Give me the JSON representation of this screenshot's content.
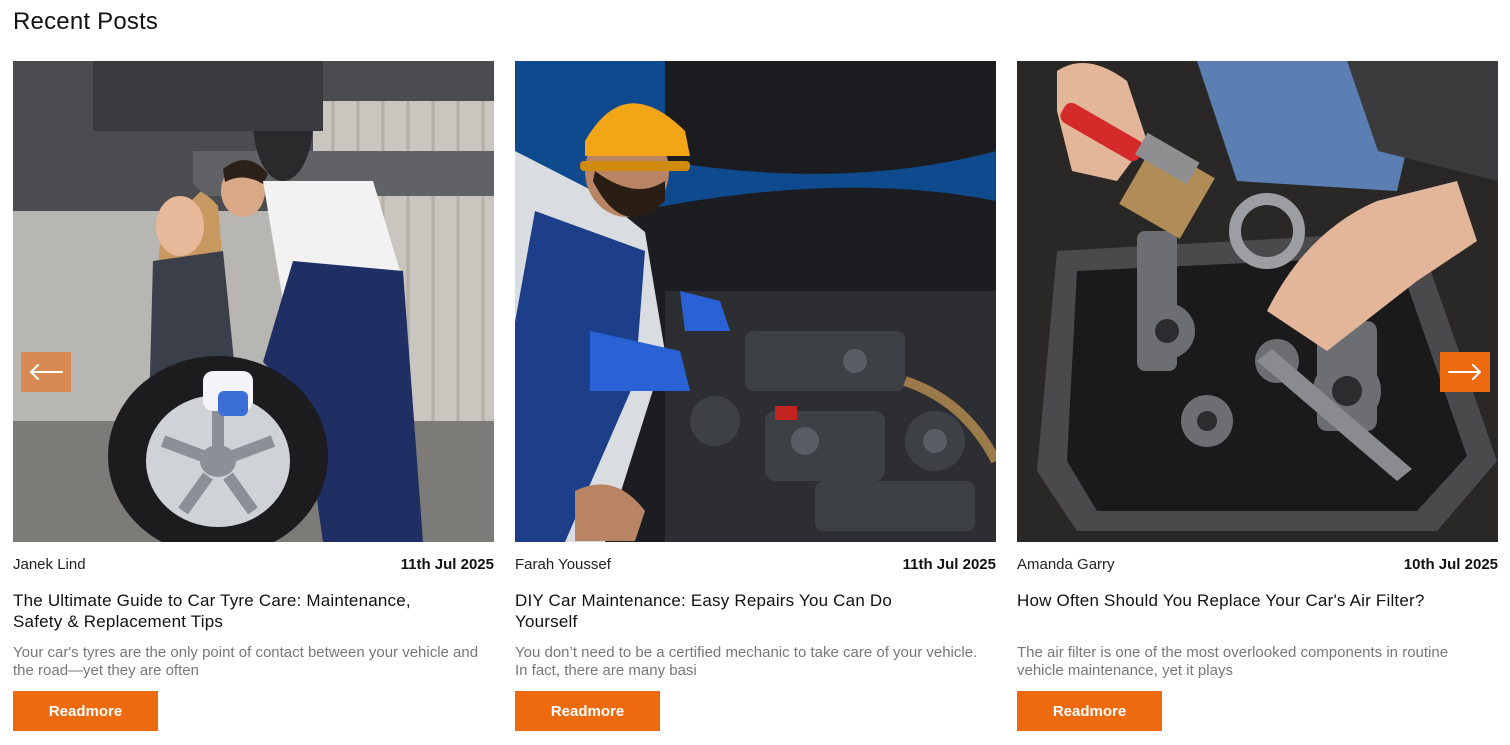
{
  "section": {
    "title": "Recent Posts"
  },
  "carousel": {
    "prev_icon": "arrow-left-icon",
    "next_icon": "arrow-right-icon"
  },
  "colors": {
    "accent": "#ee6a0f",
    "text": "#111111",
    "muted": "#777777"
  },
  "posts": [
    {
      "author": "Janek Lind",
      "date": "11th Jul 2025",
      "title": "The Ultimate Guide to Car Tyre Care: Maintenance, Safety & Replacement Tips",
      "excerpt": "Your car's tyres are the only point of contact between your vehicle and the road—yet they are often",
      "button": "Readmore",
      "image": "mechanics-with-tyre"
    },
    {
      "author": "Farah Youssef",
      "date": "11th Jul 2025",
      "title": "DIY Car Maintenance: Easy Repairs You Can Do Yourself",
      "excerpt": "You don’t need to be a certified mechanic to take care of your vehicle. In fact, there are many basi",
      "button": "Readmore",
      "image": "mechanic-engine-bay"
    },
    {
      "author": "Amanda Garry",
      "date": "10th Jul 2025",
      "title": "How Often Should You Replace Your Car's Air Filter?",
      "excerpt": "The air filter is one of the most overlooked components in routine vehicle maintenance, yet it plays",
      "button": "Readmore",
      "image": "engine-block-cleaning"
    }
  ]
}
